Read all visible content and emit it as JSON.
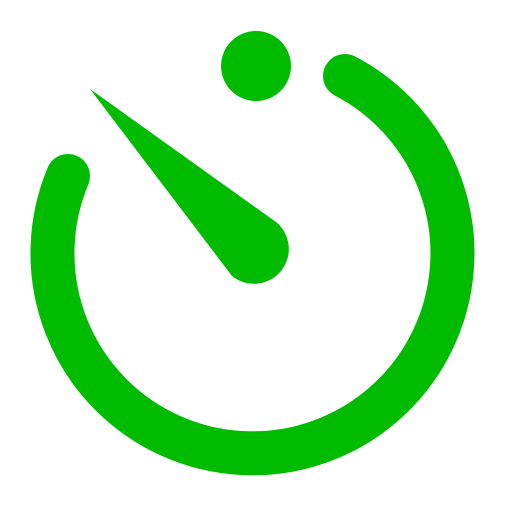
{
  "icon": {
    "name": "timer-icon",
    "color": "#00BB00",
    "background": "#FFFFFF"
  }
}
